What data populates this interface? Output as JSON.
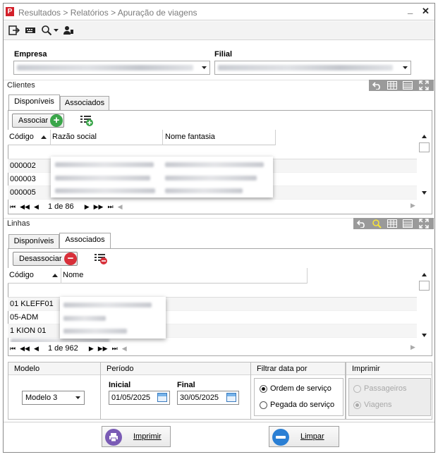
{
  "window": {
    "title": "Resultados > Relatórios > Apuração de viagens",
    "app_icon_letter": "P",
    "minimize": "_",
    "close": "✕"
  },
  "toolbar": {
    "icons": [
      "exit-icon",
      "keyboard-icon",
      "search-icon",
      "user-icon"
    ]
  },
  "empresa": {
    "label": "Empresa"
  },
  "filial": {
    "label": "Filial"
  },
  "clientes": {
    "section_title": "Clientes",
    "tabs": [
      "Disponíveis",
      "Associados"
    ],
    "associate_button": "Associar",
    "columns": [
      "Código",
      "Razão social",
      "Nome fantasia"
    ],
    "rows": [
      {
        "codigo": "000002"
      },
      {
        "codigo": "000003"
      },
      {
        "codigo": "000005"
      }
    ],
    "pager_text": "1 de 86"
  },
  "linhas": {
    "section_title": "Linhas",
    "tabs": [
      "Disponíveis",
      "Associados"
    ],
    "disassociate_button": "Desassociar",
    "columns": [
      "Código",
      "Nome"
    ],
    "rows": [
      {
        "codigo": "01 KLEFF01"
      },
      {
        "codigo": "05-ADM"
      },
      {
        "codigo": "1 KION 01"
      }
    ],
    "pager_text": "1 de 962"
  },
  "modelo": {
    "header": "Modelo",
    "selected": "Modelo 3"
  },
  "periodo": {
    "header": "Período",
    "inicial_label": "Inicial",
    "inicial_value": "01/05/2025",
    "final_label": "Final",
    "final_value": "30/05/2025"
  },
  "filtrar": {
    "header": "Filtrar data por",
    "options": [
      "Ordem de serviço",
      "Pegada do serviço"
    ],
    "selected_index": 0
  },
  "imprimir_opts": {
    "header": "Imprimir",
    "options": [
      "Passageiros",
      "Viagens"
    ]
  },
  "actions": {
    "print": "Imprimir",
    "clear": "Limpar"
  },
  "colors": {
    "add_green": "#3aa64a",
    "remove_red": "#d8303a",
    "print_purple": "#7a5bb5",
    "clear_blue": "#2a7fd4"
  }
}
